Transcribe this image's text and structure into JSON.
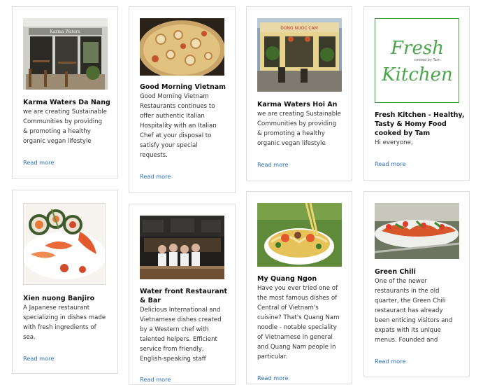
{
  "cards": [
    {
      "title": "Karma Waters Da Nang",
      "desc": "we are creating Sustainable\nCommunities by providing\n& promoting a healthy\norganic vegan lifestyle",
      "read_more": "Read more",
      "image": "restaurant-storefront-photo"
    },
    {
      "title": "Good Morning Vietnam",
      "desc": "Good Morning Vietnam\nRestaurants continues to\noffer authentic Italian\nHospitality with an Italian\nChef at your disposal to\nsatisfy your special\nrequests.",
      "read_more": "Read more",
      "image": "pizza-photo"
    },
    {
      "title": "Karma Waters Hoi An",
      "desc": "we are creating Sustainable\nCommunities by providing\n& promoting a healthy\norganic vegan lifestyle",
      "read_more": "Read more",
      "image": "restaurant-storefront-photo"
    },
    {
      "title": "Fresh Kitchen - Healthy,\nTasty & Homy Food\ncooked by Tam",
      "desc": "Hi everyone,",
      "read_more": "Read more",
      "logo_line1": "Fresh",
      "logo_small": "cooked by Tam",
      "logo_line2": "Kitchen"
    },
    {
      "title": "Xien nuong Banjiro",
      "desc": "A Japanese restaurant\nspecializing in dishes made\nwith fresh ingredients of\nsea.",
      "read_more": "Read more",
      "image": "sushi-plate-photo"
    },
    {
      "title": "Water front Restaurant\n& Bar",
      "desc": "Delicious International and\nVietnamese dishes created\nby a Western chef with\ntalented helpers. Efficient\nservice from friendly,\nEnglish-speaking staff",
      "read_more": "Read more",
      "image": "bar-staff-photo"
    },
    {
      "title": "My Quang Ngon",
      "desc": "Have you ever tried one of\nthe most famous dishes of\nCentral of Vietnam's\ncuisine? That's Quang Nam\nnoodle - notable speciality\nof Vietnamese in general\nand Quang Nam people in\nparticular.",
      "read_more": "Read more",
      "image": "noodle-bowl-photo"
    },
    {
      "title": "Green Chili",
      "desc": "One of the newer\nrestaurants in the old\nquarter, the Green Chili\nrestaurant has already\nbeen enticing visitors and\nexpats with its unique\nmenus. Founded and",
      "read_more": "Read more",
      "image": "appetizer-plate-photo"
    }
  ]
}
